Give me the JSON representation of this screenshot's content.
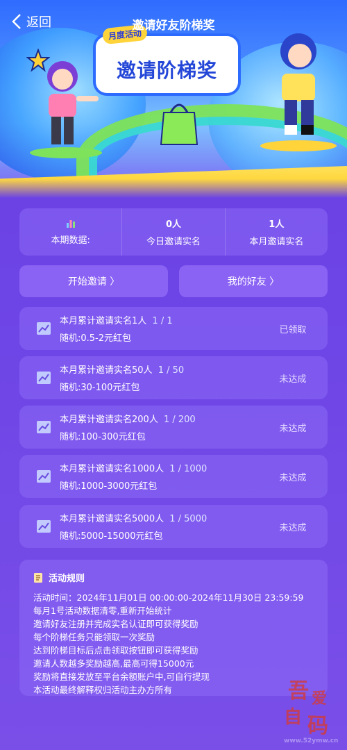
{
  "header": {
    "back_label": "返回",
    "title": "邀请好友阶梯奖"
  },
  "banner": {
    "tag": "月度活动",
    "title": "邀请阶梯奖"
  },
  "stats": {
    "period_label": "本期数据:",
    "today_count": "0人",
    "today_label": "今日邀请实名",
    "month_count": "1人",
    "month_label": "本月邀请实名"
  },
  "actions": {
    "start_invite": "开始邀请 〉",
    "my_friends": "我的好友 〉"
  },
  "tiers": [
    {
      "title": "本月累计邀请实名1人",
      "progress": "1 / 1",
      "reward": "随机:0.5-2元红包",
      "status": "已领取"
    },
    {
      "title": "本月累计邀请实名50人",
      "progress": "1 / 50",
      "reward": "随机:30-100元红包",
      "status": "未达成"
    },
    {
      "title": "本月累计邀请实名200人",
      "progress": "1 / 200",
      "reward": "随机:100-300元红包",
      "status": "未达成"
    },
    {
      "title": "本月累计邀请实名1000人",
      "progress": "1 / 1000",
      "reward": "随机:1000-3000元红包",
      "status": "未达成"
    },
    {
      "title": "本月累计邀请实名5000人",
      "progress": "1 / 5000",
      "reward": "随机:5000-15000元红包",
      "status": "未达成"
    }
  ],
  "rules": {
    "title": "活动规则",
    "lines": [
      "活动时间：2024年11月01日 00:00:00-2024年11月30日 23:59:59",
      "每月1号活动数据清零,重新开始统计",
      "邀请好友注册并完成实名认证即可获得奖励",
      "每个阶梯任务只能领取一次奖励",
      "达到阶梯目标后点击领取按钮即可获得奖励",
      "邀请人数越多奖励越高,最高可得15000元",
      "奖励将直接发放至平台余额账户中,可自行提现",
      "本活动最终解释权归活动主办方所有"
    ]
  },
  "watermark": {
    "chars": [
      "吾",
      "爱",
      "自",
      "码"
    ],
    "url": "www.52ymw.cn"
  },
  "colors": {
    "background": "#6d44e6",
    "card": "#8c69f5",
    "banner_title": "#2447d8",
    "tag_bg": "#ffd43a"
  }
}
